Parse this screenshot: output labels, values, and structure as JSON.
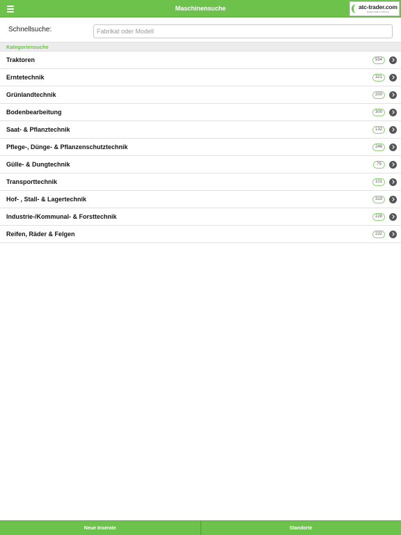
{
  "header": {
    "title": "Maschinensuche",
    "menu_icon": "hamburger-menu-icon",
    "logo": {
      "text": "atc-trader.com",
      "tagline": "Quality trade in Farmery"
    }
  },
  "quicksearch": {
    "label": "Schnellsuche:",
    "placeholder": "Fabrikat oder Modell",
    "value": ""
  },
  "categories": {
    "header": "Kategoriensuche",
    "items": [
      {
        "label": "Traktoren",
        "count": "554"
      },
      {
        "label": "Erntetechnik",
        "count": "321"
      },
      {
        "label": "Grünlandtechnik",
        "count": "200"
      },
      {
        "label": "Bodenbearbeitung",
        "count": "300"
      },
      {
        "label": "Saat- & Pflanztechnik",
        "count": "132"
      },
      {
        "label": "Pflege-, Dünge- & Pflanzenschutztechnik",
        "count": "246"
      },
      {
        "label": "Gülle- & Dungtechnik",
        "count": "75"
      },
      {
        "label": "Transporttechnik",
        "count": "101"
      },
      {
        "label": "Hof- , Stall- & Lagertechnik",
        "count": "319"
      },
      {
        "label": "Industrie-/Kommunal- & Forsttechnik",
        "count": "228"
      },
      {
        "label": "Reifen, Räder & Felgen",
        "count": "232"
      }
    ]
  },
  "footer": {
    "left_label": "Neue Inserate",
    "right_label": "Standorte"
  },
  "colors": {
    "brand_green": "#6cc24a",
    "chevron": "#555555"
  }
}
